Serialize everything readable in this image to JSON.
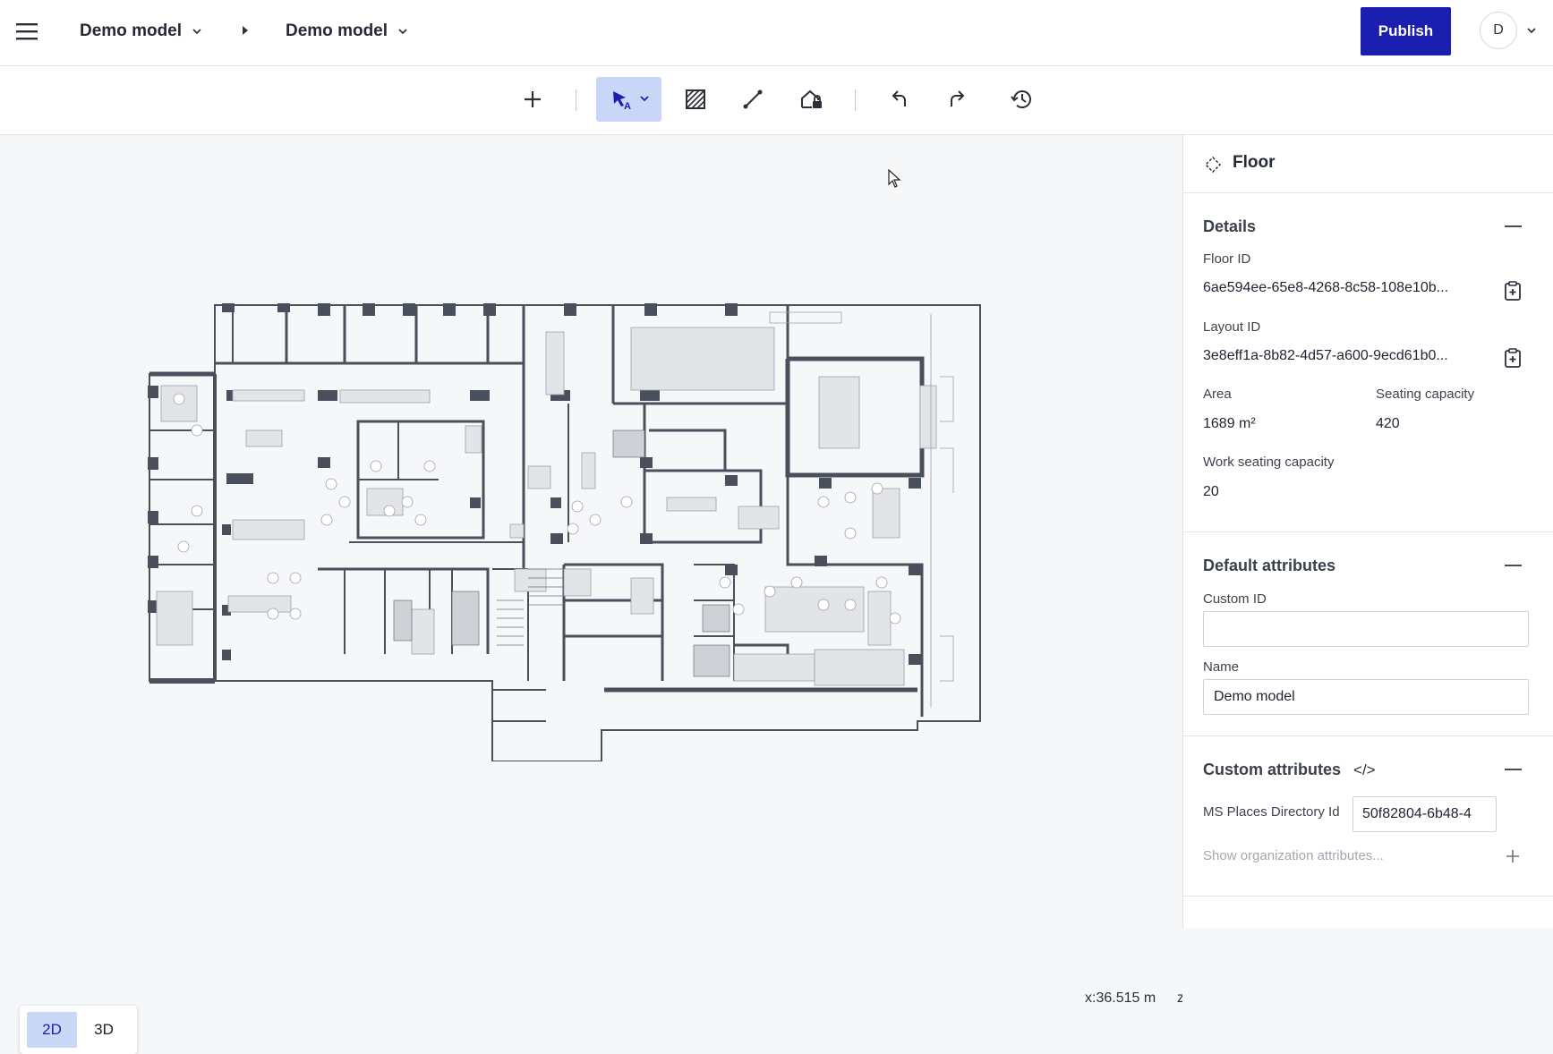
{
  "header": {
    "breadcrumb": [
      {
        "label": "Demo model"
      },
      {
        "label": "Demo model"
      }
    ],
    "publish_label": "Publish",
    "avatar_initial": "D"
  },
  "toolbar": {
    "tools": [
      "add-icon",
      "select-icon",
      "hatch-area-icon",
      "line-icon",
      "fill-shape-icon",
      "undo-icon",
      "redo-icon",
      "history-icon"
    ]
  },
  "canvas": {
    "coordinate": "x:36.515 m",
    "coordinate_next": "z",
    "view_modes": [
      "2D",
      "3D"
    ],
    "active_view": "2D"
  },
  "panel": {
    "title": "Floor",
    "details": {
      "title": "Details",
      "floor_id_label": "Floor ID",
      "floor_id": "6ae594ee-65e8-4268-8c58-108e10b...",
      "layout_id_label": "Layout ID",
      "layout_id": "3e8eff1a-8b82-4d57-a600-9ecd61b0...",
      "area_label": "Area",
      "area": "1689 m²",
      "seating_label": "Seating capacity",
      "seating": "420",
      "work_seating_label": "Work seating capacity",
      "work_seating": "20"
    },
    "default_attributes": {
      "title": "Default attributes",
      "custom_id_label": "Custom ID",
      "custom_id": "",
      "name_label": "Name",
      "name": "Demo model"
    },
    "custom_attributes": {
      "title": "Custom attributes",
      "code_icon": "</>",
      "ms_places_label": "MS Places Directory Id",
      "ms_places_value": "50f82804-6b48-4",
      "show_org_placeholder": "Show organization attributes..."
    }
  }
}
